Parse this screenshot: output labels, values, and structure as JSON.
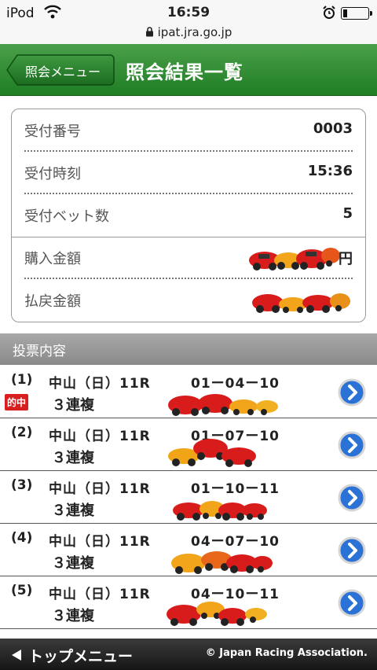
{
  "status_bar": {
    "carrier": "iPod",
    "time": "16:59",
    "url": "ipat.jra.go.jp"
  },
  "header": {
    "back_label": "照会メニュー",
    "title": "照会結果一覧"
  },
  "summary": {
    "rows": [
      {
        "label": "受付番号",
        "value": "0003"
      },
      {
        "label": "受付時刻",
        "value": "15:36"
      },
      {
        "label": "受付ベット数",
        "value": "5"
      },
      {
        "label": "購入金額",
        "value": "円"
      },
      {
        "label": "払戻金額",
        "value": ""
      }
    ]
  },
  "section": {
    "title": "投票内容"
  },
  "votes": [
    {
      "num": "(1)",
      "race": "中山（日）11R",
      "combo": "01ー04ー10",
      "type": "３連複",
      "hit": "的中"
    },
    {
      "num": "(2)",
      "race": "中山（日）11R",
      "combo": "01ー07ー10",
      "type": "３連複"
    },
    {
      "num": "(3)",
      "race": "中山（日）11R",
      "combo": "01ー10ー11",
      "type": "３連複"
    },
    {
      "num": "(4)",
      "race": "中山（日）11R",
      "combo": "04ー07ー10",
      "type": "３連複"
    },
    {
      "num": "(5)",
      "race": "中山（日）11R",
      "combo": "04ー10ー11",
      "type": "３連複"
    }
  ],
  "footer": {
    "top_label": "トップメニュー",
    "copyright": "© Japan Racing Association."
  },
  "colors": {
    "header_green": "#1f7d24",
    "hit_red": "#d81f1f",
    "arrow_blue": "#2a72d6"
  }
}
